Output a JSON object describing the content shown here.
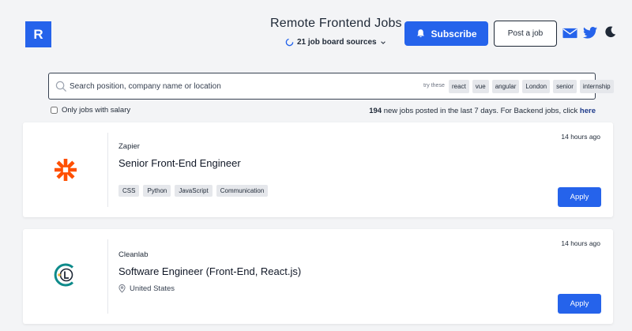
{
  "header": {
    "logo_letter": "R",
    "title": "Remote Frontend Jobs",
    "sources_label": "21 job board sources",
    "subscribe_label": "Subscribe",
    "post_job_label": "Post a job"
  },
  "search": {
    "placeholder": "Search position, company name or location",
    "try_label": "try these",
    "suggestions": [
      "react",
      "vue",
      "angular",
      "London",
      "senior",
      "internship"
    ]
  },
  "filters": {
    "salary_only_label": "Only jobs with salary"
  },
  "stats": {
    "count": "194",
    "text": " new jobs posted in the last 7 days. For Backend jobs, click ",
    "link_label": "here"
  },
  "jobs": [
    {
      "company": "Zapier",
      "title": "Senior Front-End Engineer",
      "posted": "14 hours ago",
      "skills": [
        "CSS",
        "Python",
        "JavaScript",
        "Communication"
      ],
      "apply_label": "Apply",
      "logo": "zapier-logo",
      "brand_color": "#ff4f00"
    },
    {
      "company": "Cleanlab",
      "title": "Software Engineer (Front-End, React.js)",
      "posted": "14 hours ago",
      "location": "United States",
      "apply_label": "Apply",
      "logo": "cleanlab-logo",
      "brand_color": "#0d8a8a"
    }
  ],
  "colors": {
    "accent": "#2563eb",
    "background": "#f3f4f6",
    "tag_bg": "#e5e7eb",
    "dark_text": "#1f2937"
  },
  "icons": [
    "loading-spinner-icon",
    "chevron-down-icon",
    "bell-icon",
    "mail-icon",
    "twitter-icon",
    "moon-icon",
    "search-icon",
    "location-pin-icon"
  ]
}
